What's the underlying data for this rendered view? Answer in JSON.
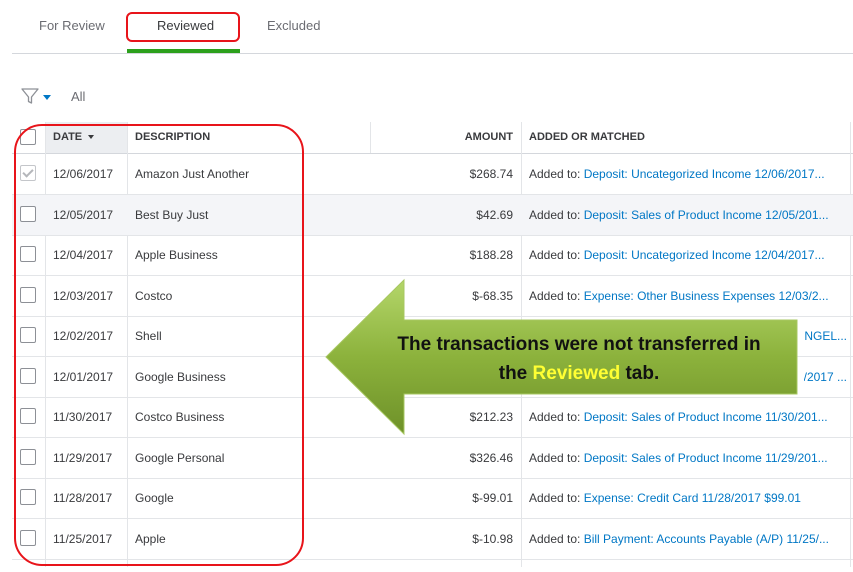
{
  "tabs": [
    {
      "label": "For Review"
    },
    {
      "label": "Reviewed"
    },
    {
      "label": "Excluded"
    }
  ],
  "filter": {
    "label": "All"
  },
  "table": {
    "headers": {
      "date": "DATE",
      "description": "DESCRIPTION",
      "amount": "AMOUNT",
      "added": "ADDED OR MATCHED"
    },
    "rows": [
      {
        "date": "12/06/2017",
        "description": "Amazon Just Another",
        "amount": "$268.74",
        "added_label": "Added to:",
        "added_link": "Deposit: Uncategorized Income 12/06/2017...",
        "checked": true
      },
      {
        "date": "12/05/2017",
        "description": "Best Buy Just",
        "amount": "$42.69",
        "added_label": "Added to:",
        "added_link": "Deposit: Sales of Product Income 12/05/201...",
        "checked": false
      },
      {
        "date": "12/04/2017",
        "description": "Apple Business",
        "amount": "$188.28",
        "added_label": "Added to:",
        "added_link": "Deposit: Uncategorized Income 12/04/2017...",
        "checked": false
      },
      {
        "date": "12/03/2017",
        "description": "Costco",
        "amount": "$-68.35",
        "added_label": "Added to:",
        "added_link": "Expense: Other Business Expenses 12/03/2...",
        "checked": false
      },
      {
        "date": "12/02/2017",
        "description": "Shell",
        "amount": "",
        "added_label": "",
        "added_link": "NGEL...",
        "checked": false
      },
      {
        "date": "12/01/2017",
        "description": "Google Business",
        "amount": "",
        "added_label": "",
        "added_link": "/2017 ...",
        "checked": false
      },
      {
        "date": "11/30/2017",
        "description": "Costco Business",
        "amount": "$212.23",
        "added_label": "Added to:",
        "added_link": "Deposit: Sales of Product Income 11/30/201...",
        "checked": false
      },
      {
        "date": "11/29/2017",
        "description": "Google Personal",
        "amount": "$326.46",
        "added_label": "Added to:",
        "added_link": "Deposit: Sales of Product Income 11/29/201...",
        "checked": false
      },
      {
        "date": "11/28/2017",
        "description": "Google",
        "amount": "$-99.01",
        "added_label": "Added to:",
        "added_link": "Expense: Credit Card 11/28/2017 $99.01",
        "checked": false
      },
      {
        "date": "11/25/2017",
        "description": "Apple",
        "amount": "$-10.98",
        "added_label": "Added to:",
        "added_link": "Bill Payment: Accounts Payable (A/P) 11/25/...",
        "checked": false
      }
    ]
  },
  "callout": {
    "line1": "The transactions were not transferred in",
    "line2_pre": "the ",
    "line2_highlight": "Reviewed",
    "line2_post": " tab."
  },
  "colors": {
    "tab_underline": "#2ca01c",
    "annotation_red": "#e8141a",
    "link_blue": "#0077c5",
    "callout_green": "#8cb23c",
    "callout_highlight": "#ffff33"
  }
}
